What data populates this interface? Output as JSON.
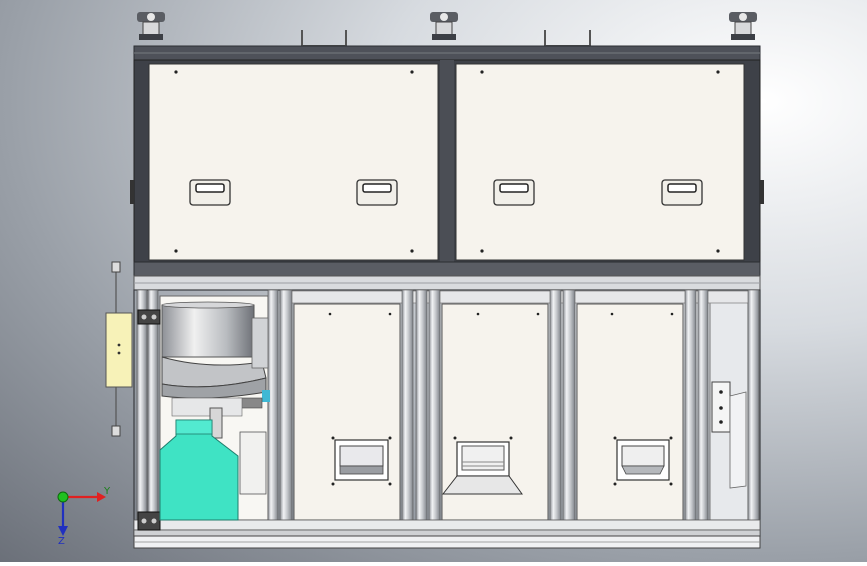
{
  "viewport": {
    "background": "#c8ccd1"
  },
  "triad": {
    "y_label": "Y",
    "z_label": "Z",
    "x_color": "#e02020",
    "y_color": "#1a7f1a",
    "z_color": "#2030c0"
  },
  "colors": {
    "frame": "#4a4d55",
    "panel": "#f6f3ed",
    "rail": "#e3e5e8",
    "green_part": "#3fe3c4",
    "yellow_box": "#f7f2b8"
  },
  "icons": {
    "levelling_foot": "levelling-foot-icon",
    "handle": "recessed-handle-icon",
    "hinge": "hinge-icon",
    "triad": "coordinate-triad-icon"
  }
}
